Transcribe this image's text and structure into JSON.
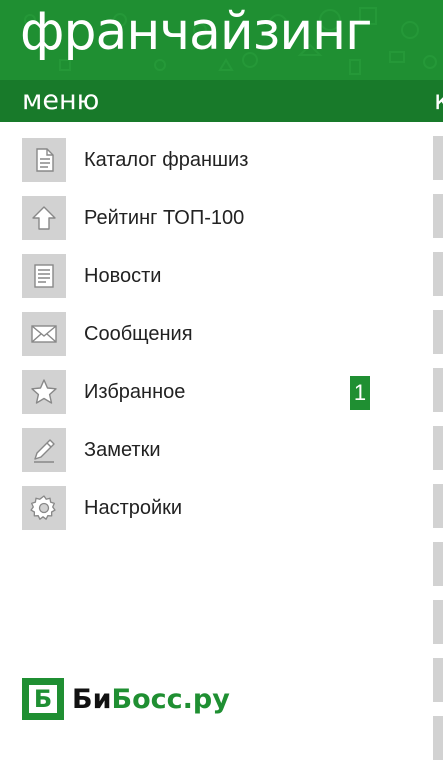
{
  "header": {
    "title": "франчайзинг",
    "section_title": "меню",
    "next_section_peek": "к"
  },
  "menu": {
    "items": [
      {
        "label": "Каталог франшиз",
        "icon": "document-icon"
      },
      {
        "label": "Рейтинг ТОП-100",
        "icon": "up-arrow-icon"
      },
      {
        "label": "Новости",
        "icon": "news-icon"
      },
      {
        "label": "Сообщения",
        "icon": "envelope-icon"
      },
      {
        "label": "Избранное",
        "icon": "star-icon",
        "badge": "1"
      },
      {
        "label": "Заметки",
        "icon": "pencil-icon"
      },
      {
        "label": "Настройки",
        "icon": "gear-icon"
      }
    ]
  },
  "footer": {
    "logo_mark": "Б",
    "logo_part1": "Би",
    "logo_part2": "Босс.ру"
  },
  "colors": {
    "brand_green": "#1f8f32",
    "dark_green_bar": "#187a2a",
    "icon_tile": "#d2d2d2"
  }
}
